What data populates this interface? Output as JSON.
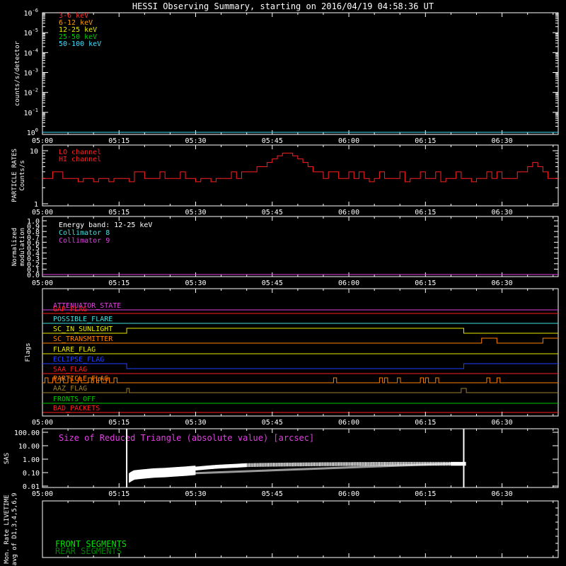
{
  "chart_data": [
    {
      "type": "line",
      "title": "HESSI Observing Summary, starting on 2016/04/19 04:58:36 UT",
      "ylabel": "counts/s/detector",
      "yscale": "log",
      "ylim": [
        1,
        100000
      ],
      "ytick_labels": [
        "10^0",
        "10^-1",
        "10^-2",
        "10^-3",
        "10^-4",
        "10^-5",
        "10^-6"
      ],
      "x_tick_labels": [
        "05:00",
        "05:15",
        "05:30",
        "05:45",
        "06:00",
        "06:15",
        "06:30"
      ],
      "x_range_minutes": [
        0,
        101
      ],
      "legend": {
        "placement": "top-left",
        "items": [
          {
            "label": "3-6 keV",
            "color": "#ff3030"
          },
          {
            "label": "6-12 keV",
            "color": "#ff9c00"
          },
          {
            "label": "12-25 keV",
            "color": "#e8e800"
          },
          {
            "label": "25-50 keV",
            "color": "#00c800"
          },
          {
            "label": "50-100 keV",
            "color": "#40e0ff"
          }
        ]
      },
      "series": [
        {
          "name": "50-100 keV",
          "color": "#40e0ff",
          "x": [
            0,
            101
          ],
          "y": [
            1,
            1
          ]
        }
      ]
    },
    {
      "type": "line",
      "ylabel": "PARTICLE RATES Counts/s",
      "yscale": "log",
      "ylim": [
        1,
        10
      ],
      "ytick_labels": [
        "10",
        "1"
      ],
      "x_tick_labels": [
        "05:00",
        "05:15",
        "05:30",
        "05:45",
        "06:00",
        "06:15",
        "06:30"
      ],
      "legend": {
        "placement": "top-left",
        "items": [
          {
            "label": "LO channel",
            "color": "#ff2020"
          },
          {
            "label": "HI channel",
            "color": "#ff2020"
          }
        ]
      },
      "series": [
        {
          "name": "LO channel",
          "color": "#ff2020",
          "x": [
            0,
            1,
            2,
            3,
            4,
            5,
            6,
            7,
            8,
            9,
            10,
            11,
            12,
            13,
            14,
            15,
            16,
            17,
            18,
            19,
            20,
            21,
            22,
            23,
            24,
            25,
            26,
            27,
            28,
            29,
            30,
            31,
            32,
            33,
            34,
            35,
            36,
            37,
            38,
            39,
            40,
            41,
            42,
            43,
            44,
            45,
            46,
            47,
            48,
            49,
            50,
            51,
            52,
            53,
            54,
            55,
            56,
            57,
            58,
            59,
            60,
            61,
            62,
            63,
            64,
            65,
            66,
            67,
            68,
            69,
            70,
            71,
            72,
            73,
            74,
            75,
            76,
            77,
            78,
            79,
            80,
            81,
            82,
            83,
            84,
            85,
            86,
            87,
            88,
            89,
            90,
            91,
            92,
            93,
            94,
            95,
            96,
            97,
            98,
            99,
            100,
            101
          ],
          "y": [
            3,
            3,
            4,
            4,
            3,
            3,
            3,
            2.6,
            3,
            3,
            2.6,
            3,
            3,
            2.6,
            3,
            3,
            3,
            2.6,
            4,
            4,
            3,
            3,
            3,
            4,
            3,
            3,
            3,
            4,
            3,
            3,
            2.6,
            3,
            3,
            2.6,
            3,
            3,
            3,
            4,
            3,
            4,
            4,
            4,
            5,
            5,
            6,
            7,
            8,
            9,
            9,
            8,
            7,
            6,
            5,
            4,
            4,
            3,
            4,
            4,
            3,
            3,
            4,
            3,
            4,
            3,
            2.6,
            3,
            4,
            3,
            3,
            3,
            4,
            2.6,
            3,
            3,
            4,
            3,
            3,
            4,
            2.6,
            3,
            3,
            4,
            3,
            3,
            2.6,
            3,
            3,
            4,
            3,
            4,
            3,
            3,
            3,
            4,
            4,
            5,
            6,
            5,
            4,
            3,
            3,
            3
          ]
        }
      ]
    },
    {
      "type": "line",
      "ylabel": "Normalized modulation",
      "ylim": [
        0,
        1
      ],
      "ytick_labels": [
        "0.0",
        "0.1",
        "0.2",
        "0.3",
        "0.4",
        "0.5",
        "0.6",
        "0.7",
        "0.8",
        "0.9",
        "1.0"
      ],
      "x_tick_labels": [
        "05:00",
        "05:15",
        "05:30",
        "05:45",
        "06:00",
        "06:15",
        "06:30"
      ],
      "legend": {
        "placement": "top-left",
        "items": [
          {
            "label": "Energy band: 12-25 keV",
            "color": "#ffffff"
          },
          {
            "label": "Collimator 8",
            "color": "#40e0e0"
          },
          {
            "label": "Collimator 9",
            "color": "#e040e0"
          }
        ]
      },
      "series": [
        {
          "name": "Collimator 9",
          "color": "#e040e0",
          "x": [
            0,
            101
          ],
          "y": [
            0,
            0
          ]
        }
      ]
    },
    {
      "type": "line",
      "ylabel": "Flags",
      "x_tick_labels": [
        "05:00",
        "05:15",
        "05:30",
        "05:45",
        "06:00",
        "06:15",
        "06:30"
      ],
      "flags": [
        {
          "label": "ATTENUATOR_STATE",
          "color": "#e040e0"
        },
        {
          "label": "GAP_FLAG",
          "color": "#ff2020"
        },
        {
          "label": "POSSIBLE_FLARE",
          "color": "#40e0e0"
        },
        {
          "label": "SC_IN_SUNLIGHT",
          "color": "#e8e800"
        },
        {
          "label": "SC_TRANSMITTER",
          "color": "#ff8000"
        },
        {
          "label": "FLARE_FLAG",
          "color": "#e8e800"
        },
        {
          "label": "ECLIPSE_FLAG",
          "color": "#2040ff"
        },
        {
          "label": "SAA_FLAG",
          "color": "#ff2020"
        },
        {
          "label": "PARTICLE_FLAG",
          "color": "#ff8000"
        },
        {
          "label": "AAZ_FLAG",
          "color": "#a08030"
        },
        {
          "label": "FRONTS_OFF",
          "color": "#00c800"
        },
        {
          "label": "BAD_PACKETS",
          "color": "#ff2020"
        }
      ]
    },
    {
      "type": "line",
      "ylabel": "SAS",
      "yscale": "log",
      "ylim": [
        0.01,
        100
      ],
      "ytick_labels": [
        "100.00",
        "10.00",
        "1.00",
        "0.10",
        "0.01"
      ],
      "x_tick_labels": [
        "05:00",
        "05:15",
        "05:30",
        "05:45",
        "06:00",
        "06:15",
        "06:30"
      ],
      "annotation": {
        "text": "Size of Reduced Triangle (absolute value) [arcsec]",
        "color": "#e040e0"
      },
      "series": [
        {
          "color": "#ffffff",
          "x": [
            16.5,
            17,
            18,
            20,
            22,
            24,
            26,
            28,
            30,
            32,
            34,
            36,
            38,
            40,
            45,
            50,
            55,
            60,
            65,
            70,
            75,
            80,
            83
          ],
          "y": [
            100,
            0.06,
            0.1,
            0.12,
            0.14,
            0.15,
            0.17,
            0.19,
            0.22,
            0.26,
            0.3,
            0.33,
            0.36,
            0.4,
            0.43,
            0.45,
            0.47,
            0.48,
            0.49,
            0.5,
            0.5,
            0.5,
            0.5
          ]
        }
      ]
    },
    {
      "type": "line",
      "ylabel": "Mon. Rate LIVETIME avg of D1,3,4,5,6,9",
      "x_tick_labels": [],
      "legend": {
        "placement": "bottom-left",
        "items": [
          {
            "label": "FRONT SEGMENTS",
            "color": "#00e000"
          },
          {
            "label": "REAR SEGMENTS",
            "color": "#008000"
          }
        ]
      }
    }
  ]
}
